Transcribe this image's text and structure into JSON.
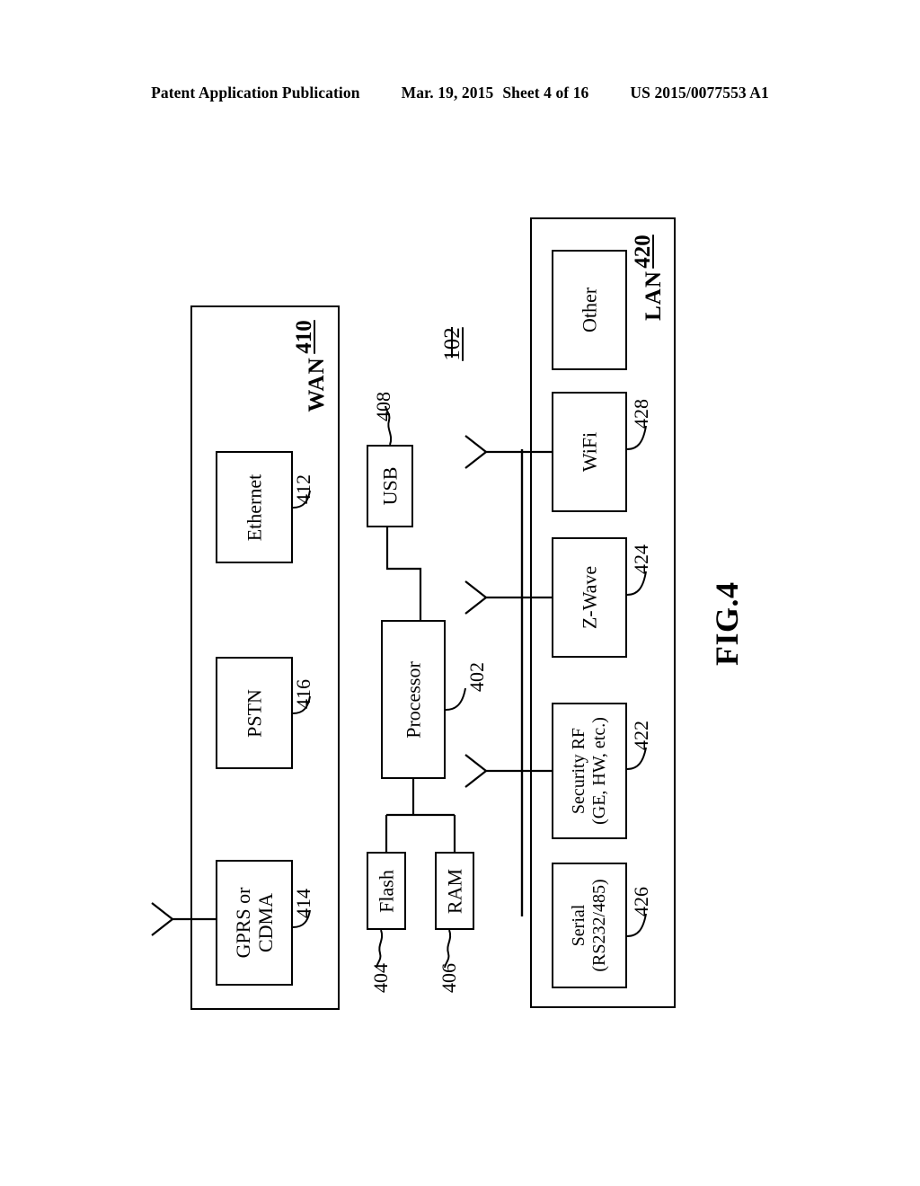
{
  "header": {
    "publication": "Patent Application Publication",
    "date": "Mar. 19, 2015",
    "sheet": "Sheet 4 of 16",
    "docket": "US 2015/0077553 A1"
  },
  "figure": {
    "label": "FIG.4",
    "system_ref": "102"
  },
  "wan_group": {
    "title": "WAN",
    "ref": "410",
    "blocks": [
      {
        "label": "Ethernet",
        "ref": "412"
      },
      {
        "label": "PSTN",
        "ref": "416"
      },
      {
        "label": "GPRS or\nCDMA",
        "label_line1": "GPRS or",
        "label_line2": "CDMA",
        "ref": "414"
      }
    ]
  },
  "core": {
    "processor": {
      "label": "Processor",
      "ref": "402"
    },
    "usb": {
      "label": "USB",
      "ref": "408"
    },
    "flash": {
      "label": "Flash",
      "ref": "404"
    },
    "ram": {
      "label": "RAM",
      "ref": "406"
    }
  },
  "lan_group": {
    "title": "LAN",
    "ref": "420",
    "blocks": [
      {
        "label": "Other",
        "ref": ""
      },
      {
        "label": "WiFi",
        "ref": "428"
      },
      {
        "label": "Z-Wave",
        "ref": "424"
      },
      {
        "label_line1": "Security RF",
        "label_line2": "(GE, HW, etc.)",
        "ref": "422"
      },
      {
        "label_line1": "Serial",
        "label_line2": "(RS232/485)",
        "ref": "426"
      }
    ]
  },
  "icons": {
    "antenna": "antenna-icon"
  },
  "colors": {
    "ink": "#000000",
    "paper": "#ffffff"
  }
}
